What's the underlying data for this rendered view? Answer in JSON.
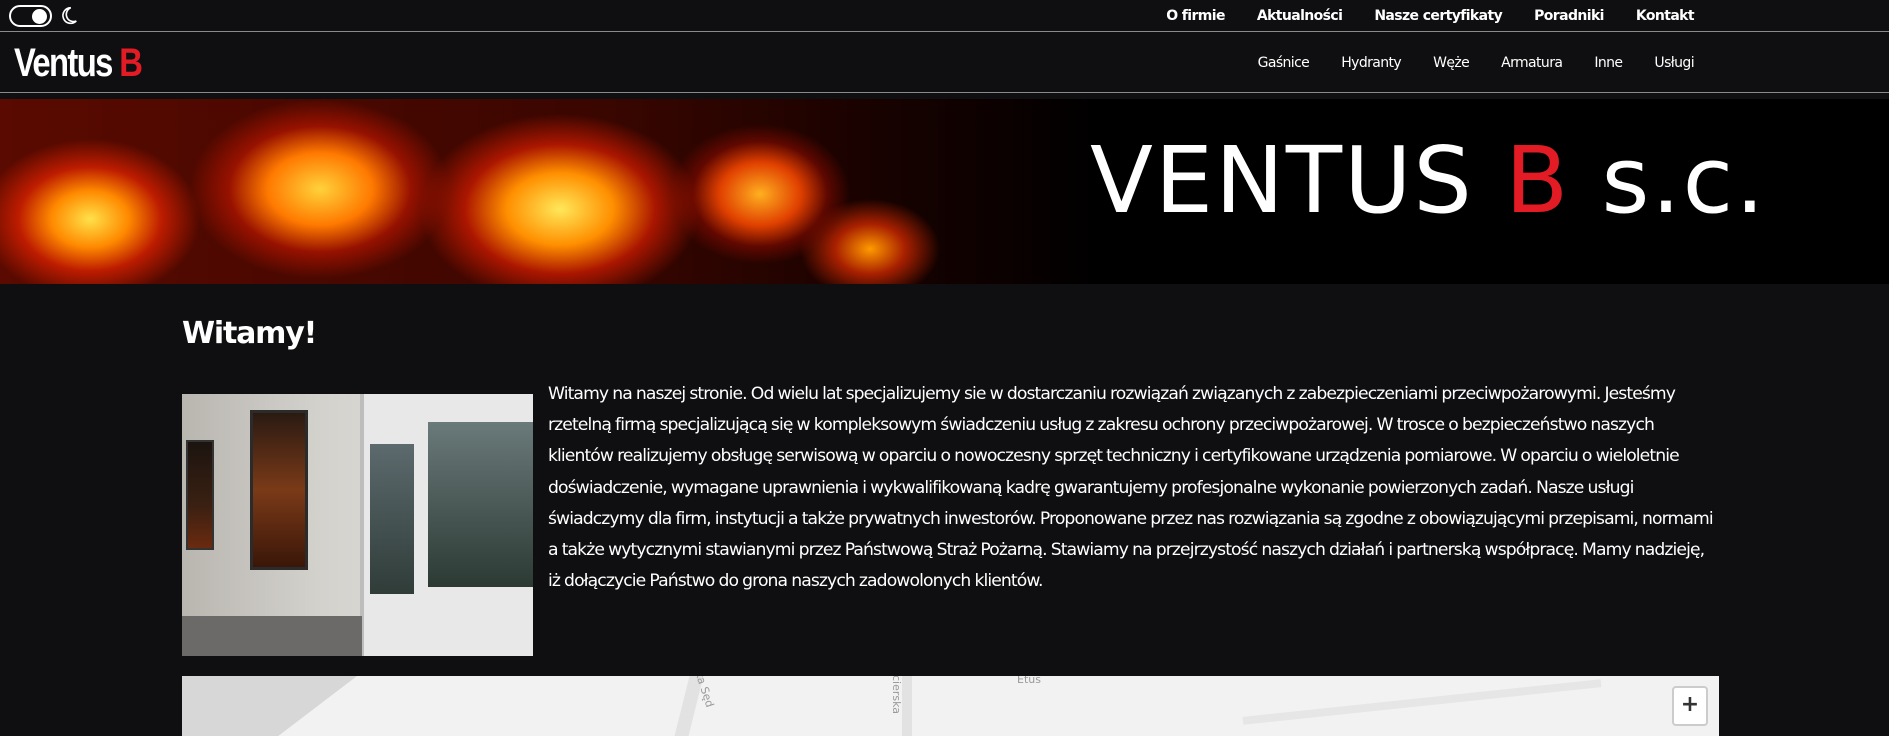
{
  "top_bar": {
    "theme_toggle_state": "on",
    "links": [
      "O firmie",
      "Aktualności",
      "Nasze certyfikaty",
      "Poradniki",
      "Kontakt"
    ]
  },
  "main_bar": {
    "logo_text": "Ventus",
    "logo_accent": "B",
    "nav": [
      "Gaśnice",
      "Hydranty",
      "Węże",
      "Armatura",
      "Inne",
      "Usługi"
    ]
  },
  "banner": {
    "title_text": "VENTUS",
    "title_accent": "B",
    "title_suffix": "s.c."
  },
  "content": {
    "heading": "Witamy!",
    "paragraph": "Witamy na naszej stronie. Od wielu lat specjalizujemy sie w dostarczaniu rozwiązań związanych z zabezpieczeniami przeciwpożarowymi. Jesteśmy rzetelną firmą specjalizującą się w kompleksowym świadczeniu usług z zakresu ochrony przeciwpożarowej. W trosce o bezpieczeństwo naszych klientów realizujemy obsługę serwisową w oparciu o nowoczesny sprzęt techniczny i certyfikowane urządzenia pomiarowe. W oparciu o wieloletnie doświadczenie, wymagane uprawnienia i wykwalifikowaną kadrę gwarantujemy profesjonalne wykonanie powierzonych zadań. Nasze usługi świadczymy dla firm, instytucji a także prywatnych inwestorów. Proponowane przez nas rozwiązania są zgodne z obowiązującymi przepisami, normami a także wytycznymi stawianymi przez Państwową Straż Pożarną. Stawiamy na przejrzystość naszych działań i partnerską współpracę. Mamy nadzieję, iż dołączycie Państwo do grona naszych zadowolonych klientów."
  },
  "map": {
    "street_labels": [
      "ska Sęd",
      "cierska",
      "Etus"
    ],
    "zoom_in_label": "+"
  },
  "colors": {
    "background": "#0f0f11",
    "accent_red": "#e21b24",
    "text": "#ffffff"
  }
}
